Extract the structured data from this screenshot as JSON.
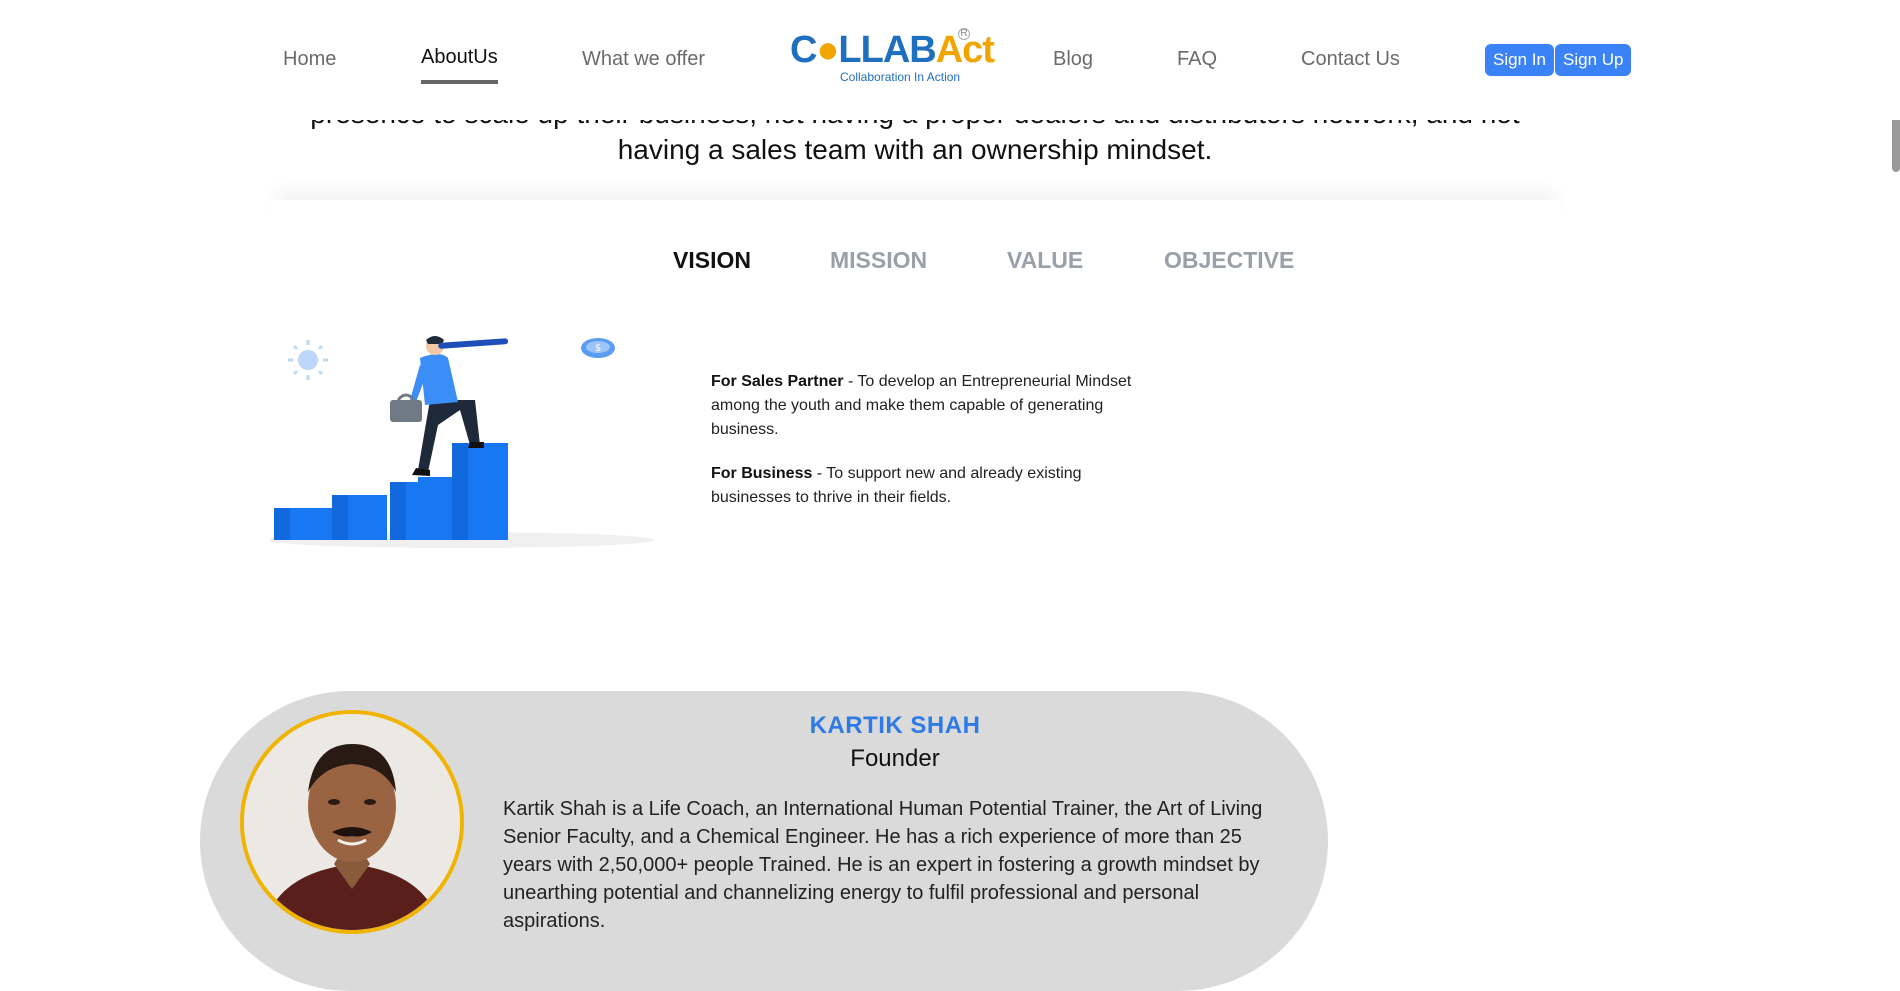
{
  "nav": {
    "links": [
      {
        "label": "Home"
      },
      {
        "label": "AboutUs"
      },
      {
        "label": "What we offer"
      },
      {
        "label": "Blog"
      },
      {
        "label": "FAQ"
      },
      {
        "label": "Contact Us"
      }
    ],
    "logo": {
      "brand_part1": "C",
      "brand_part2": "LLAB",
      "brand_part3": "Act",
      "tagline": "Collaboration In Action",
      "registered": "R"
    },
    "sign_in": "Sign In",
    "sign_up": "Sign Up"
  },
  "intro": {
    "text": "presence to scale up their business, not having a proper dealers and distributors network, and not having a sales team with an ownership mindset."
  },
  "tabs": [
    {
      "label": "VISION",
      "active": true
    },
    {
      "label": "MISSION",
      "active": false
    },
    {
      "label": "VALUE",
      "active": false
    },
    {
      "label": "OBJECTIVE",
      "active": false
    }
  ],
  "vision": {
    "items": [
      {
        "title": "For Sales Partner",
        "text": " - To develop an Entrepreneurial Mindset among the youth and make them capable of generating business."
      },
      {
        "title": "For Business",
        "text": " - To support new and already existing businesses to thrive in their fields."
      }
    ]
  },
  "founder": {
    "name": "KARTIK SHAH",
    "role": "Founder",
    "bio": "Kartik Shah is a Life Coach, an International Human Potential Trainer, the Art of Living Senior Faculty, and a Chemical Engineer. He has a rich experience of more than 25 years with 2,50,000+ people Trained. He is an expert in fostering a growth mindset by unearthing potential and channelizing energy to fulfil professional and personal aspirations."
  },
  "colors": {
    "accent": "#3b82f6",
    "founder_name": "#2f7be5",
    "avatar_ring": "#f0b400",
    "card_bg": "#dadada"
  }
}
